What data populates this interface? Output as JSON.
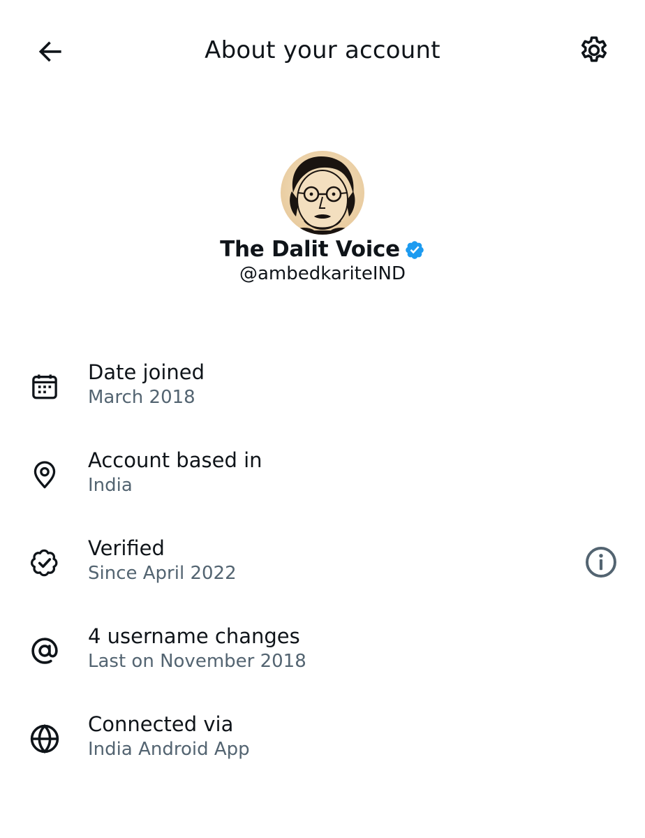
{
  "header": {
    "title": "About your account",
    "back_icon": "arrow-left-icon",
    "settings_icon": "gear-icon"
  },
  "profile": {
    "display_name": "The Dalit Voice",
    "handle": "@ambedkariteIND",
    "verified": true,
    "badge_color": "#1d9bf0"
  },
  "rows": [
    {
      "icon": "calendar-icon",
      "label": "Date joined",
      "sub": "March 2018"
    },
    {
      "icon": "location-pin-icon",
      "label": "Account based in",
      "sub": "India"
    },
    {
      "icon": "verified-badge-outline-icon",
      "label": "Verified",
      "sub": "Since April 2022",
      "has_info": true
    },
    {
      "icon": "at-sign-icon",
      "label": "4 username changes",
      "sub": "Last on November 2018"
    },
    {
      "icon": "globe-icon",
      "label": "Connected via",
      "sub": "India Android App"
    }
  ],
  "colors": {
    "text_primary": "#0f1419",
    "text_secondary": "#536471",
    "icon": "#0f1419",
    "info_icon": "#536471"
  }
}
